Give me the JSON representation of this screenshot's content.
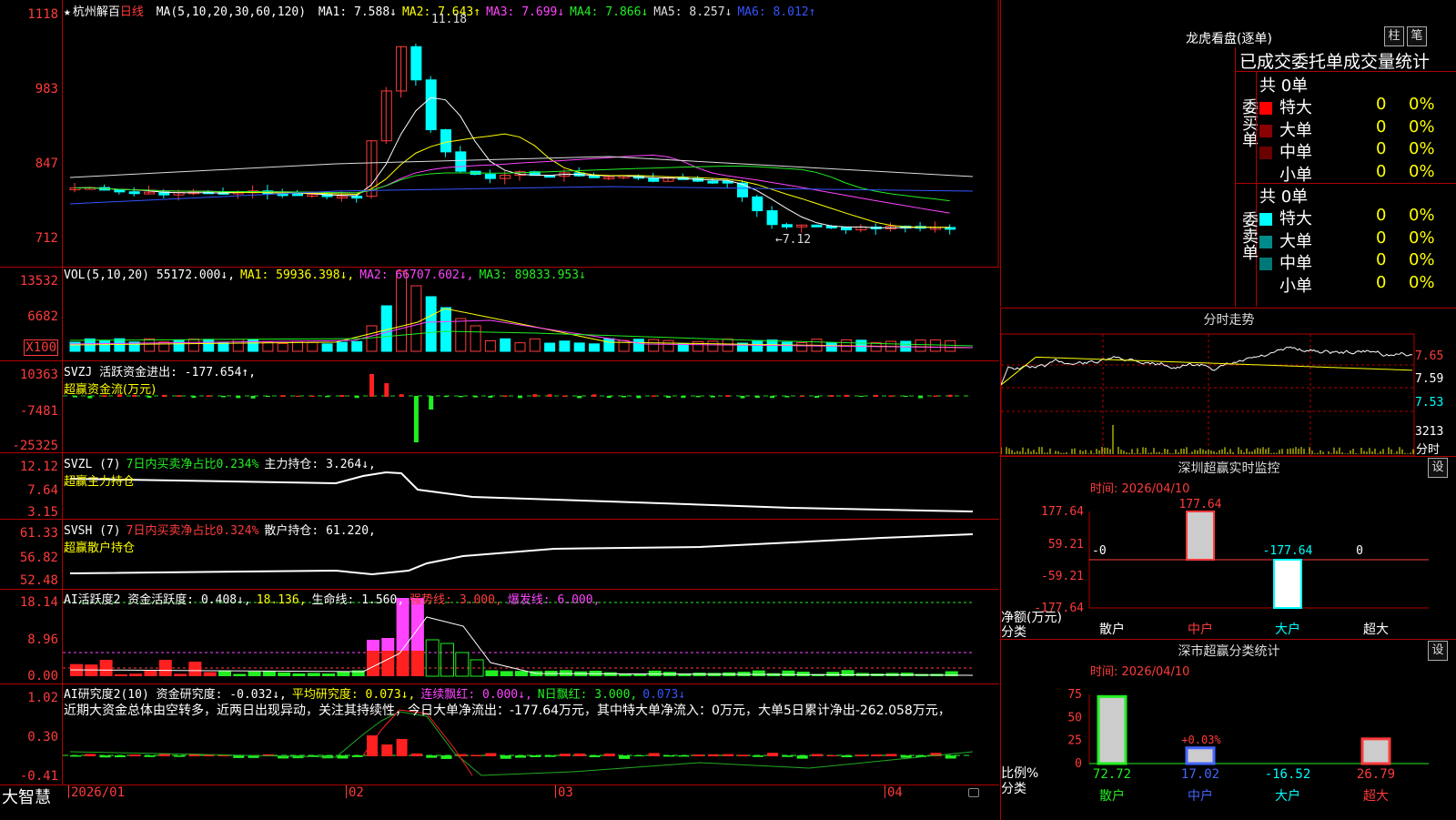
{
  "footer": {
    "brand": "大智慧",
    "dates": [
      "2026/01",
      "02",
      "03",
      "04"
    ]
  },
  "panel1": {
    "star": "★",
    "stock_name": "杭州解百",
    "period": "日线",
    "ma_header": "MA(5,10,20,30,60,120)",
    "ma_items": [
      {
        "label": "MA1: 7.588↓",
        "color": "#ffffff"
      },
      {
        "label": "MA2: 7.643↑",
        "color": "#ffff00"
      },
      {
        "label": "MA3: 7.699↓",
        "color": "#ff44ff"
      },
      {
        "label": "MA4: 7.866↓",
        "color": "#22ee22"
      },
      {
        "label": "MA5: 8.257↓",
        "color": "#dddddd"
      },
      {
        "label": "MA6: 8.012↑",
        "color": "#3355ff"
      }
    ],
    "yticks": [
      "1118",
      "983",
      "847",
      "712"
    ],
    "high_label": "11.18",
    "low_label": "←7.12"
  },
  "panel2": {
    "header": "VOL(5,10,20)",
    "items": [
      {
        "label": "55172.000↓,",
        "color": "#ffffff"
      },
      {
        "label": "MA1: 59936.398↓,",
        "color": "#ffff00"
      },
      {
        "label": "MA2: 66707.602↓,",
        "color": "#ff44ff"
      },
      {
        "label": "MA3: 89833.953↓",
        "color": "#22ee22"
      }
    ],
    "yticks": [
      "13532",
      "6682"
    ],
    "unit": "X100"
  },
  "panel3": {
    "line1": "SVZJ  活跃资金进出: -177.654↑,",
    "line2": "超赢资金流(万元)",
    "yticks": [
      "10363",
      "-7481",
      "-25325"
    ]
  },
  "panel4": {
    "prefix": "SVZL (7)",
    "ratio": "7日内买卖净占比0.234%",
    "hold": "主力持仓: 3.264↓,",
    "line2": "超赢主力持仓",
    "yticks": [
      "12.12",
      "7.64",
      "3.15"
    ]
  },
  "panel5": {
    "prefix": "SVSH (7)",
    "ratio": "7日内买卖净占比0.324%",
    "hold": "散户持仓: 61.220,",
    "line2": "超赢散户持仓",
    "yticks": [
      "61.33",
      "56.82",
      "52.48"
    ]
  },
  "panel6": {
    "items": [
      {
        "label": "AI活跃度2 资金活跃度: 0.408↓,",
        "color": "#ffffff"
      },
      {
        "label": "18.136,",
        "color": "#ffff00"
      },
      {
        "label": "生命线: 1.560,",
        "color": "#ffffff"
      },
      {
        "label": "强势线: 3.000,",
        "color": "#ff3b3b"
      },
      {
        "label": "爆发线: 6.000,",
        "color": "#ff44ff"
      }
    ],
    "yticks": [
      "18.14",
      "8.96",
      "0.00"
    ]
  },
  "panel7": {
    "items": [
      {
        "label": "AI研究度2(10) 资金研究度: -0.032↓,",
        "color": "#ffffff"
      },
      {
        "label": "平均研究度: 0.073↓,",
        "color": "#ffff00"
      },
      {
        "label": "连续飘红: 0.000↓,",
        "color": "#ff44ff"
      },
      {
        "label": "N日飘红: 3.000,",
        "color": "#22ee22"
      },
      {
        "label": "0.073↓",
        "color": "#3355ff"
      }
    ],
    "comment": "近期大资金总体由空转多，近两日出现异动，关注其持续性，今日大单净流出：-177.64万元，其中特大单净流入：0万元，大单5日累计净出-262.058万元，",
    "yticks": [
      "1.02",
      "0.30",
      "-0.41"
    ]
  },
  "lhb": {
    "title": "龙虎看盘(逐单)",
    "btn1": "柱",
    "btn2": "笔",
    "subtitle": "已成交委托单成交量统计",
    "buy_label": "委买单",
    "sell_label": "委卖单",
    "buy_total": "共 0单",
    "sell_total": "共 0单",
    "buy_rows": [
      {
        "name": "特大",
        "count": "0",
        "pct": "0%",
        "color": "#ff0000"
      },
      {
        "name": "大单",
        "count": "0",
        "pct": "0%",
        "color": "#8b0000"
      },
      {
        "name": "中单",
        "count": "0",
        "pct": "0%",
        "color": "#6b0000"
      },
      {
        "name": "小单",
        "count": "0",
        "pct": "0%",
        "color": "#000000"
      }
    ],
    "sell_rows": [
      {
        "name": "特大",
        "count": "0",
        "pct": "0%",
        "color": "#00ffff"
      },
      {
        "name": "大单",
        "count": "0",
        "pct": "0%",
        "color": "#008b8b"
      },
      {
        "name": "中单",
        "count": "0",
        "pct": "0%",
        "color": "#007777"
      },
      {
        "name": "小单",
        "count": "0",
        "pct": "0%",
        "color": "#000000"
      }
    ]
  },
  "intraday": {
    "title": "分时走势",
    "yticks": [
      "7.65",
      "7.59",
      "7.53"
    ],
    "vol_label": "3213",
    "vol_unit": "分时"
  },
  "monitor": {
    "title": "深圳超赢实时监控",
    "btn": "设",
    "time": "时间: 2026/04/10",
    "yticks": [
      "177.64",
      "59.21",
      "-59.21",
      "-177.64"
    ],
    "ylabel": "净额(万元)",
    "xlabel": "分类",
    "categories": [
      "散户",
      "中户",
      "大户",
      "超大"
    ],
    "cat_colors": [
      "#ffffff",
      "#ff3b3b",
      "#00ffff",
      "#ffffff"
    ],
    "value_labels": [
      "-0",
      "177.64",
      "-177.64",
      "0"
    ]
  },
  "classify": {
    "title": "深市超赢分类统计",
    "btn": "设",
    "time": "时间: 2026/04/10",
    "yticks": [
      "75",
      "50",
      "25",
      "0"
    ],
    "ylabel": "比例%",
    "xlabel": "分类",
    "categories": [
      "散户",
      "中户",
      "大户",
      "超大"
    ],
    "cat_colors": [
      "#22ee22",
      "#4466ff",
      "#00ffff",
      "#ff3b3b"
    ],
    "value_labels": [
      "72.72",
      "17.02",
      "-16.52",
      "26.79"
    ],
    "mid_label": "+0.03%"
  },
  "chart_data": [
    {
      "type": "bar",
      "title": "深圳超赢实时监控",
      "ylabel": "净额(万元)",
      "categories": [
        "散户",
        "中户",
        "大户",
        "超大"
      ],
      "values": [
        0,
        177.64,
        -177.64,
        0
      ],
      "ylim": [
        -177.64,
        177.64
      ]
    },
    {
      "type": "bar",
      "title": "深市超赢分类统计",
      "ylabel": "比例%",
      "categories": [
        "散户",
        "中户",
        "大户",
        "超大"
      ],
      "values": [
        72.72,
        17.02,
        -16.52,
        26.79
      ],
      "ylim": [
        0,
        75
      ]
    }
  ]
}
